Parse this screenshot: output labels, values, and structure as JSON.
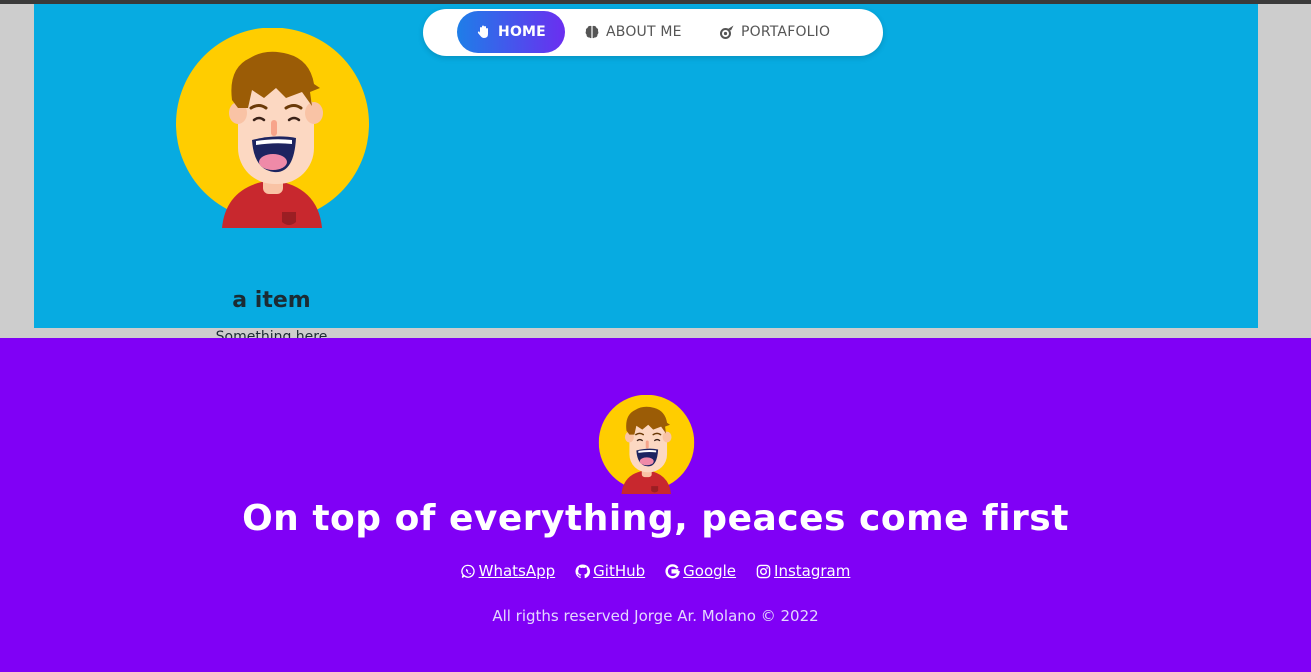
{
  "nav": {
    "items": [
      {
        "label": "HOME",
        "icon": "hand-wave-icon"
      },
      {
        "label": "ABOUT ME",
        "icon": "brain-icon"
      },
      {
        "label": "PORTAFOLIO",
        "icon": "meteor-icon"
      }
    ]
  },
  "card": {
    "title": "a item",
    "subtitle": "Something here"
  },
  "footer": {
    "slogan": "On top of everything, peaces come first",
    "links": [
      {
        "label": "WhatsApp",
        "icon": "whatsapp-icon"
      },
      {
        "label": "GitHub",
        "icon": "github-icon"
      },
      {
        "label": "Google",
        "icon": "google-icon"
      },
      {
        "label": "Instagram",
        "icon": "instagram-icon"
      }
    ],
    "copyright": "All rigths reserved Jorge Ar. Molano © 2022"
  },
  "colors": {
    "hero_bg": "#07abe1",
    "footer_bg": "#8000f6",
    "nav_active_from": "#1e7ee8",
    "nav_active_to": "#6b2ef0",
    "avatar_circle": "#ffcd00",
    "shirt": "#c8282e"
  }
}
